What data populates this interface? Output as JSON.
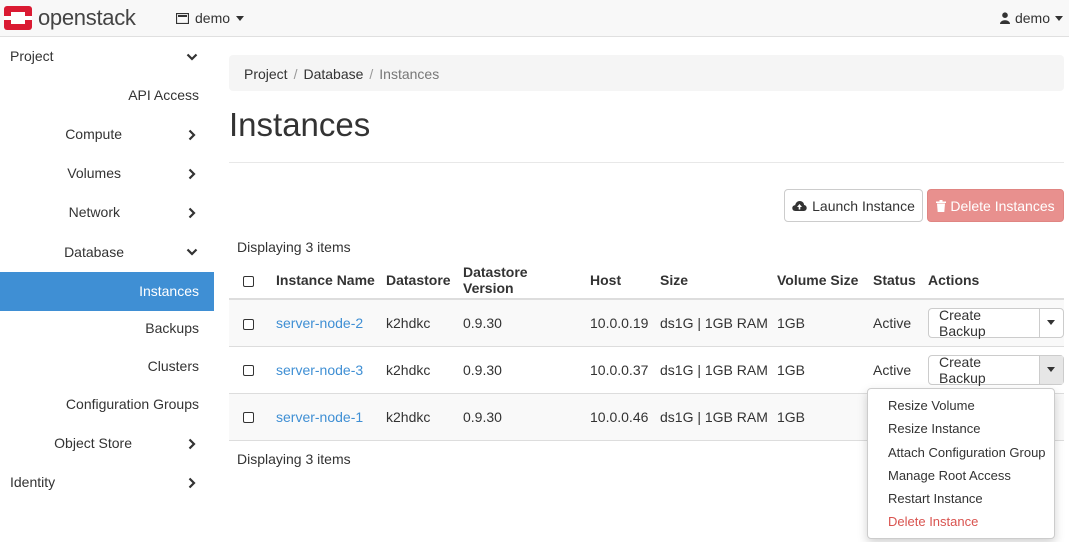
{
  "navbar": {
    "brand": "openstack",
    "project_switch": "demo",
    "user": "demo"
  },
  "sidebar": {
    "items": [
      {
        "label": "Project",
        "level": 0,
        "chevron": "down"
      },
      {
        "label": "API Access",
        "level": 1,
        "chevron": ""
      },
      {
        "label": "Compute",
        "level": 1,
        "chevron": "right"
      },
      {
        "label": "Volumes",
        "level": 1,
        "chevron": "right"
      },
      {
        "label": "Network",
        "level": 1,
        "chevron": "right"
      },
      {
        "label": "Database",
        "level": 1,
        "chevron": "down"
      },
      {
        "label": "Instances",
        "level": 2,
        "chevron": "",
        "active": true
      },
      {
        "label": "Backups",
        "level": 2,
        "chevron": ""
      },
      {
        "label": "Clusters",
        "level": 2,
        "chevron": ""
      },
      {
        "label": "Configuration Groups",
        "level": 2,
        "chevron": ""
      },
      {
        "label": "Object Store",
        "level": 1,
        "chevron": "right"
      },
      {
        "label": "Identity",
        "level": 0,
        "chevron": "right"
      }
    ]
  },
  "breadcrumb": [
    "Project",
    "Database",
    "Instances"
  ],
  "page_title": "Instances",
  "actions": {
    "launch": "Launch Instance",
    "delete": "Delete Instances"
  },
  "table": {
    "count_top": "Displaying 3 items",
    "count_bottom": "Displaying 3 items",
    "columns": [
      "Instance Name",
      "Datastore",
      "Datastore Version",
      "Host",
      "Size",
      "Volume Size",
      "Status",
      "Actions"
    ],
    "rows": [
      {
        "name": "server-node-2",
        "datastore": "k2hdkc",
        "version": "0.9.30",
        "host": "10.0.0.19",
        "size": "ds1G | 1GB RAM",
        "volume": "1GB",
        "status": "Active",
        "action": "Create Backup"
      },
      {
        "name": "server-node-3",
        "datastore": "k2hdkc",
        "version": "0.9.30",
        "host": "10.0.0.37",
        "size": "ds1G | 1GB RAM",
        "volume": "1GB",
        "status": "Active",
        "action": "Create Backup"
      },
      {
        "name": "server-node-1",
        "datastore": "k2hdkc",
        "version": "0.9.30",
        "host": "10.0.0.46",
        "size": "ds1G | 1GB RAM",
        "volume": "1GB",
        "status": "",
        "action": ""
      }
    ]
  },
  "row_menu": {
    "items": [
      "Resize Volume",
      "Resize Instance",
      "Attach Configuration Group",
      "Manage Root Access",
      "Restart Instance",
      "Delete Instance"
    ]
  },
  "colors": {
    "brand_red": "#da1a32",
    "active_blue": "#3f8fd4",
    "danger": "#d9534f"
  }
}
